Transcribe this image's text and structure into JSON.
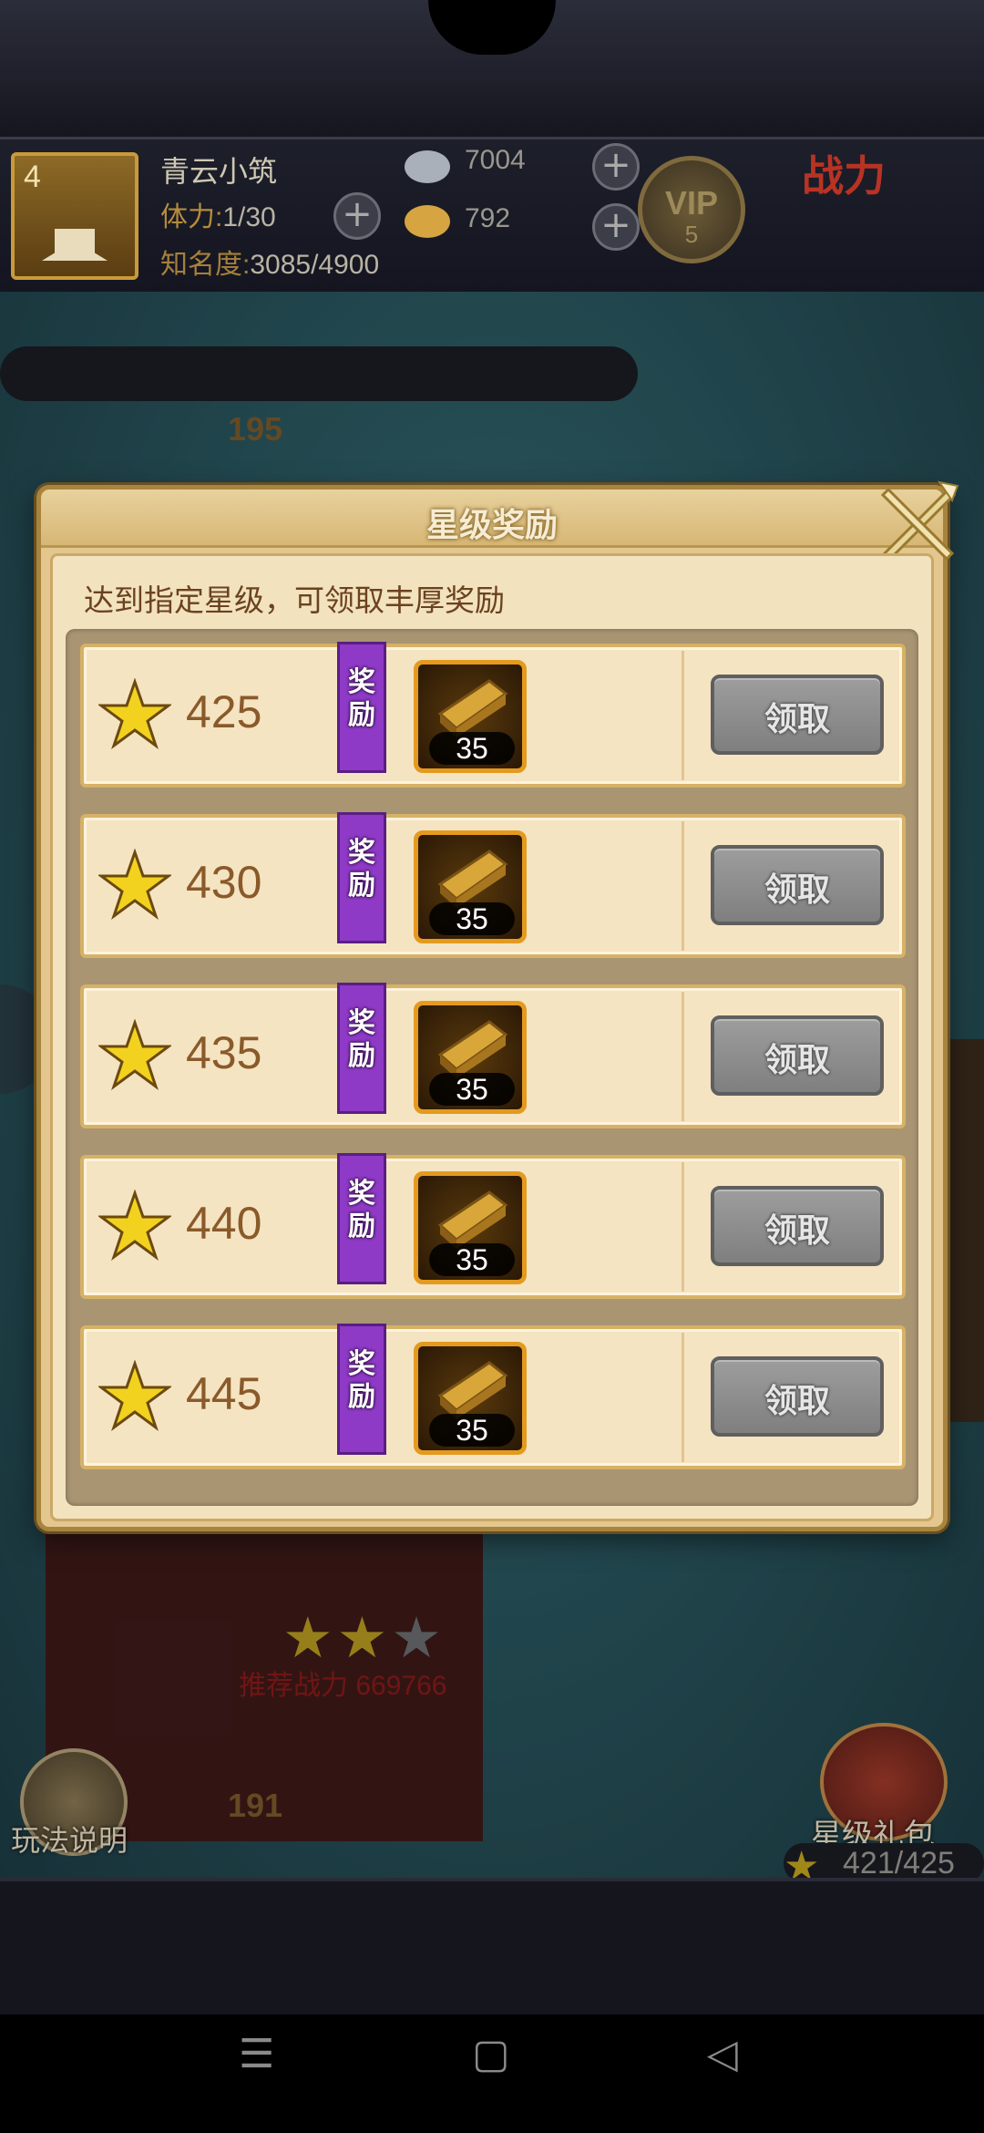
{
  "player": {
    "level": "4",
    "name": "青云小筑",
    "stamina_label": "体力:",
    "stamina_value": "1/30",
    "fame_label": "知名度:",
    "fame_value": "3085/4900",
    "silver": "7004",
    "gold": "792",
    "vip_label": "VIP",
    "vip_level": "5",
    "power_label": "战力"
  },
  "scene": {
    "count_upper": "195",
    "count_lower": "191",
    "recommended_power": "推荐战力 669766",
    "stars_filled": 2,
    "stars_total": 3,
    "help_label": "玩法说明",
    "gift_label": "星级礼包",
    "gift_progress": "421/425"
  },
  "modal": {
    "title": "星级奖励",
    "subtitle": "达到指定星级，可领取丰厚奖励",
    "reward_tag": "奖励",
    "rewards": [
      {
        "stars": "425",
        "item": "gold-ingot-icon",
        "count": "35",
        "button": "领取"
      },
      {
        "stars": "430",
        "item": "gold-ingot-icon",
        "count": "35",
        "button": "领取"
      },
      {
        "stars": "435",
        "item": "gold-ingot-icon",
        "count": "35",
        "button": "领取"
      },
      {
        "stars": "440",
        "item": "gold-ingot-icon",
        "count": "35",
        "button": "领取"
      },
      {
        "stars": "445",
        "item": "gold-ingot-icon",
        "count": "35",
        "button": "领取"
      }
    ]
  },
  "nav": {
    "menu": "☰",
    "home": "▢",
    "back": "◁"
  },
  "colors": {
    "modal_bg": "#e3c78e",
    "row_bg": "#f5e4c2",
    "reward_tag": "#8e3ac6",
    "claim_disabled": "#8f8f8f",
    "star_gold": "#f2d21f"
  }
}
